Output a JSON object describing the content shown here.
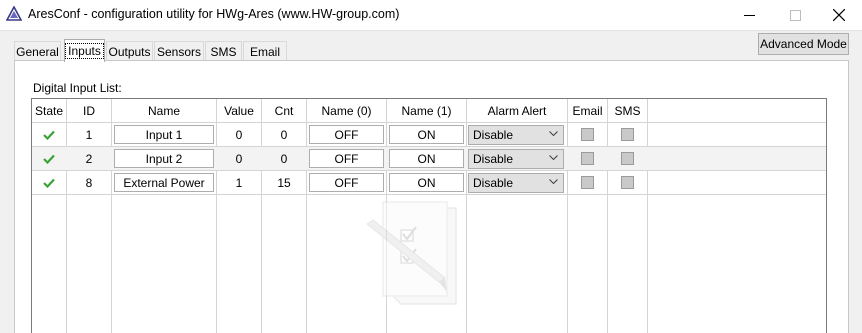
{
  "window": {
    "title": "AresConf - configuration utility for HWg-Ares (www.HW-group.com)",
    "minimize_icon": "minimize-icon",
    "maximize_icon": "maximize-icon",
    "close_icon": "close-icon"
  },
  "tabs": [
    {
      "label": "General"
    },
    {
      "label": "Inputs",
      "active": true
    },
    {
      "label": "Outputs"
    },
    {
      "label": "Sensors"
    },
    {
      "label": "SMS"
    },
    {
      "label": "Email"
    }
  ],
  "toolbar": {
    "advanced_mode_label": "Advanced Mode"
  },
  "input_list": {
    "caption": "Digital Input List:",
    "columns": [
      "State",
      "ID",
      "Name",
      "Value",
      "Cnt",
      "Name (0)",
      "Name (1)",
      "Alarm Alert",
      "Email",
      "SMS"
    ],
    "rows": [
      {
        "state_icon": "check-icon",
        "id": "1",
        "name": "Input 1",
        "value": "0",
        "cnt": "0",
        "name0": "OFF",
        "name1": "ON",
        "alarm_alert": "Disable",
        "email": false,
        "sms": false
      },
      {
        "state_icon": "check-icon",
        "id": "2",
        "name": "Input 2",
        "value": "0",
        "cnt": "0",
        "name0": "OFF",
        "name1": "ON",
        "alarm_alert": "Disable",
        "email": false,
        "sms": false
      },
      {
        "state_icon": "check-icon",
        "id": "8",
        "name": "External Power",
        "value": "1",
        "cnt": "15",
        "name0": "OFF",
        "name1": "ON",
        "alarm_alert": "Disable",
        "email": false,
        "sms": false
      }
    ],
    "empty_watermark_icon": "checklist-document-icon"
  },
  "colors": {
    "state_ok": "#3aa335"
  }
}
